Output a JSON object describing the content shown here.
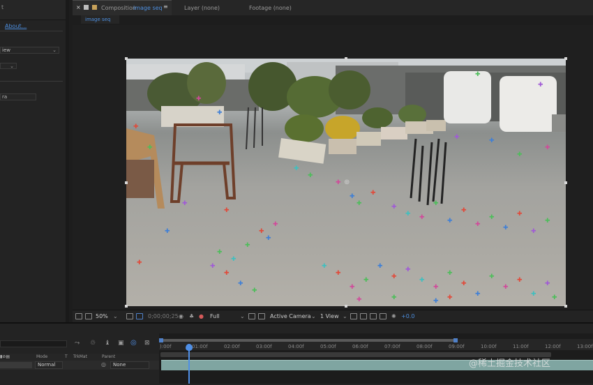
{
  "left_panel": {
    "about_link": "About...",
    "dropdown1_value": "iew",
    "field_value": "ra"
  },
  "tabs": {
    "composition_prefix": "Composition",
    "composition_name": "image seq",
    "menu_glyph": "≡",
    "layer": "Layer (none)",
    "footage": "Footage (none)"
  },
  "viewer": {
    "sub_tab": "image seq",
    "zoom": "50%",
    "timecode": "0;00;00;25",
    "resolution": "Full",
    "camera": "Active Camera",
    "views": "1 View",
    "exposure": "+0.0"
  },
  "timeline": {
    "columns": {
      "mode": "Mode",
      "t": "T",
      "trkmat": "TrkMat",
      "parent": "Parent"
    },
    "layer_mode": "Normal",
    "layer_parent": "None",
    "ruler_ticks": [
      "):00f",
      "01:00f",
      "02:00f",
      "03:00f",
      "04:00f",
      "05:00f",
      "06:00f",
      "07:00f",
      "08:00f",
      "09:00f",
      "10:00f",
      "11:00f",
      "12:00f",
      "13:00f"
    ]
  },
  "watermark": "@稀土掘金技术社区",
  "colors": {
    "accent": "#4d8fe0",
    "panel": "#232323",
    "track": "#7fa5a1"
  }
}
